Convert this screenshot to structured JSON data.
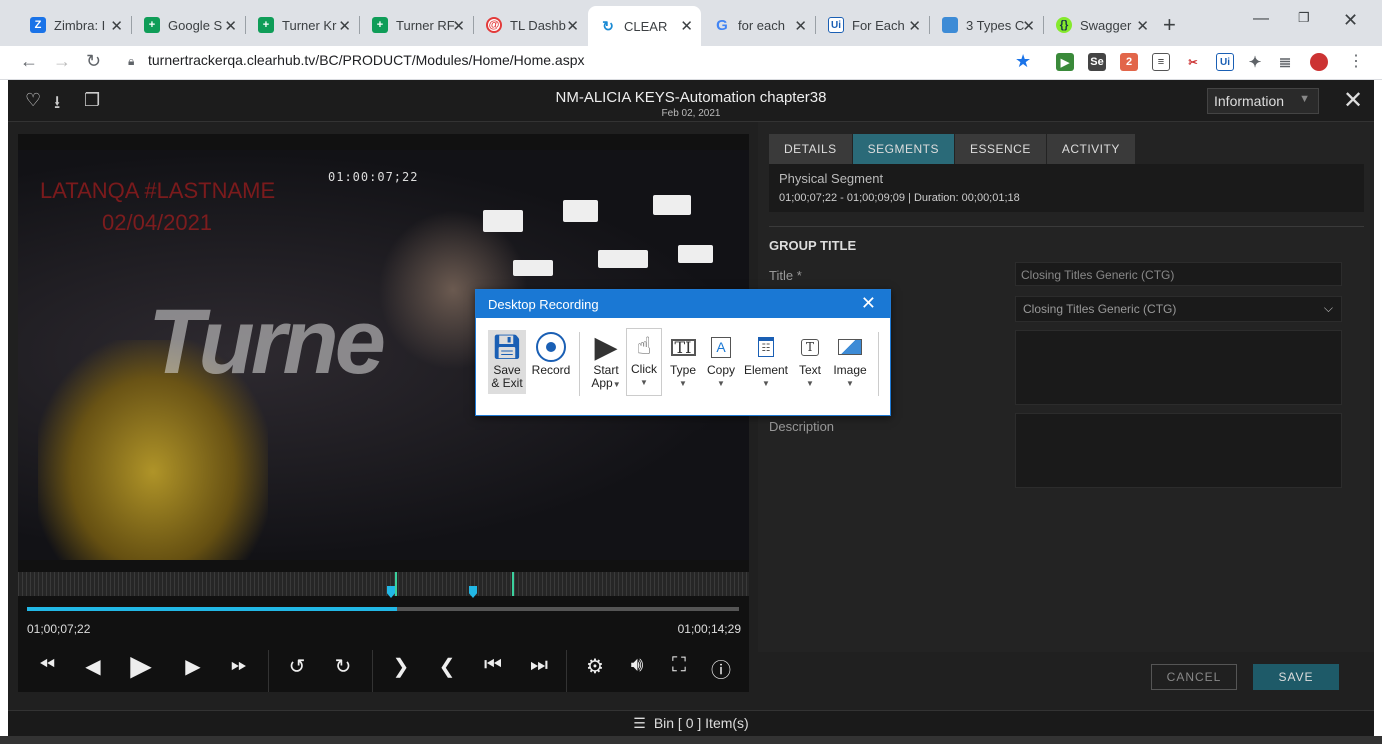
{
  "browser": {
    "tabs": [
      {
        "title": "Zimbra: I",
        "icon": "zimbra-icon",
        "color": "#1a73e8"
      },
      {
        "title": "Google S",
        "icon": "sheets-icon",
        "color": "#0f9d58"
      },
      {
        "title": "Turner Kr",
        "icon": "sheets-icon",
        "color": "#0f9d58"
      },
      {
        "title": "Turner RF",
        "icon": "sheets-icon",
        "color": "#0f9d58"
      },
      {
        "title": "TL Dashb",
        "icon": "tl-icon",
        "color": "#e33b3b"
      },
      {
        "title": "CLEAR",
        "icon": "clear-icon",
        "color": "#1a8ad4"
      },
      {
        "title": "for each",
        "icon": "google-icon",
        "color": "#4285f4"
      },
      {
        "title": "For Each",
        "icon": "uipath-icon",
        "color": "#1a5fb4"
      },
      {
        "title": "3 Types C",
        "icon": "page-icon",
        "color": "#3d8bd6"
      },
      {
        "title": "Swagger",
        "icon": "swagger-icon",
        "color": "#85ea2d"
      }
    ],
    "url": "turnertrackerqa.clearhub.tv/BC/PRODUCT/Modules/Home/Home.aspx"
  },
  "app": {
    "title": "NM-ALICIA KEYS-Automation chapter38",
    "date": "Feb 02, 2021",
    "info_select": "Information"
  },
  "video": {
    "timecode_overlay": "01:00:07;22",
    "watermark_line1": "LATANQA #LASTNAME",
    "watermark_line2": "02/04/2021",
    "big_watermark": "Turne",
    "start_tc": "01;00;07;22",
    "end_tc": "01;00;14;29",
    "progress_pct": 52
  },
  "panel": {
    "tabs": [
      "DETAILS",
      "SEGMENTS",
      "ESSENCE",
      "ACTIVITY"
    ],
    "active_tab": 1,
    "segment_label": "Physical Segment",
    "segment_range": "01;00;07;22  -  01;00;09;09  | Duration: 00;00;01;18",
    "group_title": "GROUP TITLE",
    "title_label": "Title *",
    "title_value": "Closing Titles Generic (CTG)",
    "select_value": "Closing Titles Generic (CTG)",
    "description_label": "Description",
    "cancel": "CANCEL",
    "save": "SAVE"
  },
  "bin": {
    "label": "Bin  [ 0 ] Item(s)"
  },
  "recording": {
    "title": "Desktop Recording",
    "tools": [
      {
        "label1": "Save",
        "label2": "& Exit"
      },
      {
        "label1": "Record",
        "label2": ""
      },
      {
        "label1": "Start",
        "label2": "App"
      },
      {
        "label1": "Click",
        "label2": ""
      },
      {
        "label1": "Type",
        "label2": ""
      },
      {
        "label1": "Copy",
        "label2": ""
      },
      {
        "label1": "Element",
        "label2": ""
      },
      {
        "label1": "Text",
        "label2": ""
      },
      {
        "label1": "Image",
        "label2": ""
      }
    ]
  }
}
